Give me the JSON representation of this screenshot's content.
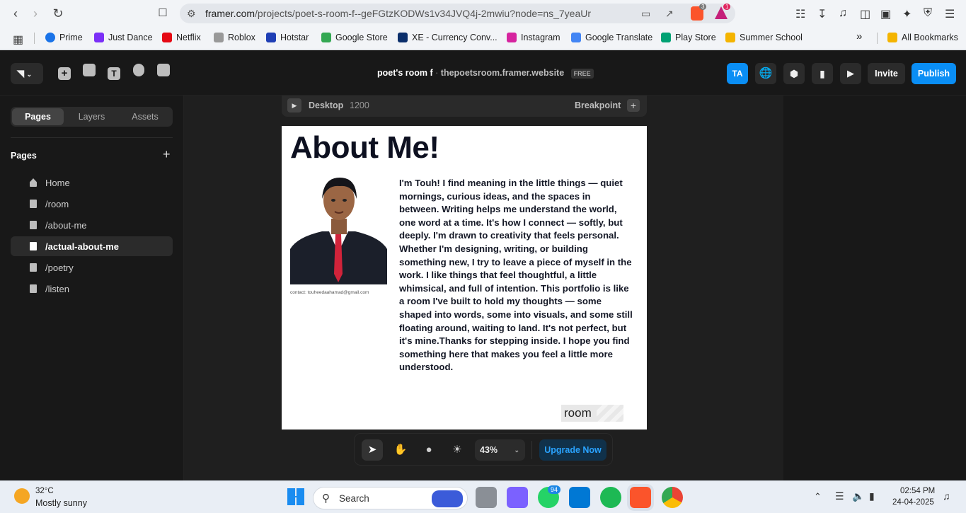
{
  "browser": {
    "url_host": "framer.com",
    "url_path": "/projects/poet-s-room-f--geFGtzKODWs1v34JVQ4j-2mwiu?node=ns_7yeaUr",
    "brave_badge": "3",
    "rewards_badge": "1"
  },
  "bookmarks": [
    {
      "label": "Prime",
      "color": "#1a73e8"
    },
    {
      "label": "Just Dance",
      "color": "#7b2ff7"
    },
    {
      "label": "Netflix",
      "color": "#e50914"
    },
    {
      "label": "Roblox",
      "color": "#999999"
    },
    {
      "label": "Hotstar",
      "color": "#1f3fb5"
    },
    {
      "label": "Google Store",
      "color": "#34a853"
    },
    {
      "label": "XE - Currency Conv...",
      "color": "#0b2f6b"
    },
    {
      "label": "Instagram",
      "color": "#d6249f"
    },
    {
      "label": "Google Translate",
      "color": "#4285f4"
    },
    {
      "label": "Play Store",
      "color": "#00a173"
    },
    {
      "label": "Summer School",
      "color": "#f4b400"
    }
  ],
  "all_bookmarks": "All Bookmarks",
  "framer": {
    "project_name": "poet's room f",
    "site_domain": "thepoetsroom.framer.website",
    "plan_badge": "FREE",
    "avatar_initials": "TA",
    "invite_label": "Invite",
    "publish_label": "Publish",
    "tabs": [
      "Pages",
      "Layers",
      "Assets"
    ],
    "pages_heading": "Pages",
    "pages": [
      {
        "label": "Home",
        "icon": "home-icon"
      },
      {
        "label": "/room",
        "icon": "page-icon"
      },
      {
        "label": "/about-me",
        "icon": "page-icon"
      },
      {
        "label": "/actual-about-me",
        "icon": "page-icon",
        "active": true
      },
      {
        "label": "/poetry",
        "icon": "page-icon"
      },
      {
        "label": "/listen",
        "icon": "page-icon"
      }
    ],
    "breakpoint_name": "Desktop",
    "breakpoint_width": "1200",
    "breakpoint_label": "Breakpoint",
    "zoom": "43%",
    "upgrade_label": "Upgrade Now"
  },
  "page_content": {
    "title": "About Me!",
    "contact": "contact: touheedaahamad@gmail.com",
    "bio": "I'm Touh! I find meaning in the little things — quiet mornings, curious ideas, and the spaces in between. Writing helps me understand the world, one word at a time. It's how I connect — softly, but deeply. I'm drawn to creativity that feels personal. Whether I'm designing, writing, or building something new, I try to leave a piece of myself in the work. I like things that feel thoughtful, a little whimsical, and full of intention. This portfolio is like a room I've built to hold my thoughts — some shaped into words, some into visuals, and some still floating around, waiting to land. It's not perfect, but it's mine.Thanks for stepping inside. I hope you find something here that makes you feel a little more understood.",
    "room_label": "room"
  },
  "taskbar": {
    "temperature": "32°C",
    "weather": "Mostly sunny",
    "search_label": "Search",
    "whatsapp_badge": "94",
    "time": "02:54 PM",
    "date": "24-04-2025"
  }
}
